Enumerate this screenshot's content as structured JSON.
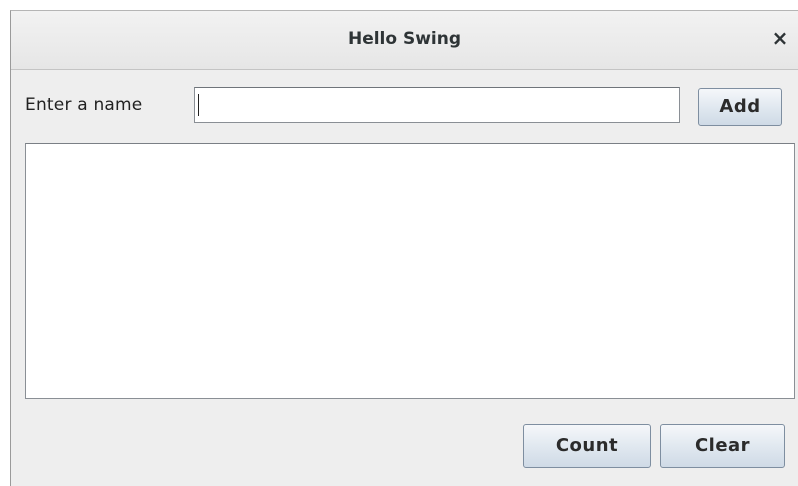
{
  "window": {
    "title": "Hello Swing",
    "close_glyph": "×"
  },
  "form": {
    "label": "Enter a name",
    "input_value": "",
    "input_placeholder": "",
    "add_label": "Add"
  },
  "list": {
    "items": []
  },
  "footer": {
    "count_label": "Count",
    "clear_label": "Clear"
  },
  "colors": {
    "window_bg": "#eeeeee",
    "button_gradient_top": "#f5f7fa",
    "button_gradient_bottom": "#cfdae6",
    "button_border": "#7e8ea0"
  },
  "icons": {
    "close": "close-icon"
  }
}
